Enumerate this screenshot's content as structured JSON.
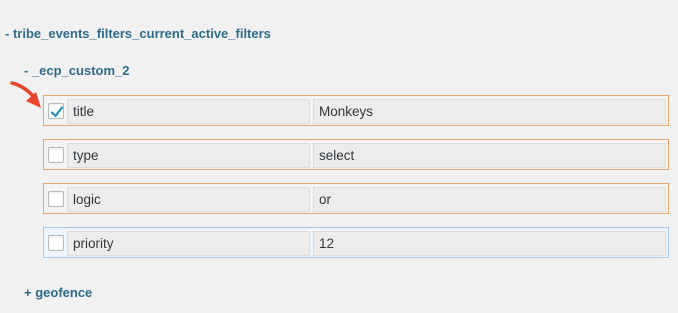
{
  "tree": {
    "root_label": "- tribe_events_filters_current_active_filters",
    "child_label": "- _ecp_custom_2",
    "geofence_label": "+ geofence"
  },
  "rows": [
    {
      "key": "title",
      "value": "Monkeys",
      "checked": true,
      "highlight": "orange"
    },
    {
      "key": "type",
      "value": "select",
      "checked": false,
      "highlight": "orange"
    },
    {
      "key": "logic",
      "value": "or",
      "checked": false,
      "highlight": "orange"
    },
    {
      "key": "priority",
      "value": "12",
      "checked": false,
      "highlight": "blue"
    }
  ],
  "colors": {
    "link": "#2f6c8c",
    "orange_border": "#e5a66c",
    "blue_border": "#a8c7e6",
    "checkmark": "#1e8cbe",
    "arrow": "#e8452c"
  },
  "icons": {
    "arrow": "red-arrow-icon",
    "check": "checkmark-icon"
  }
}
